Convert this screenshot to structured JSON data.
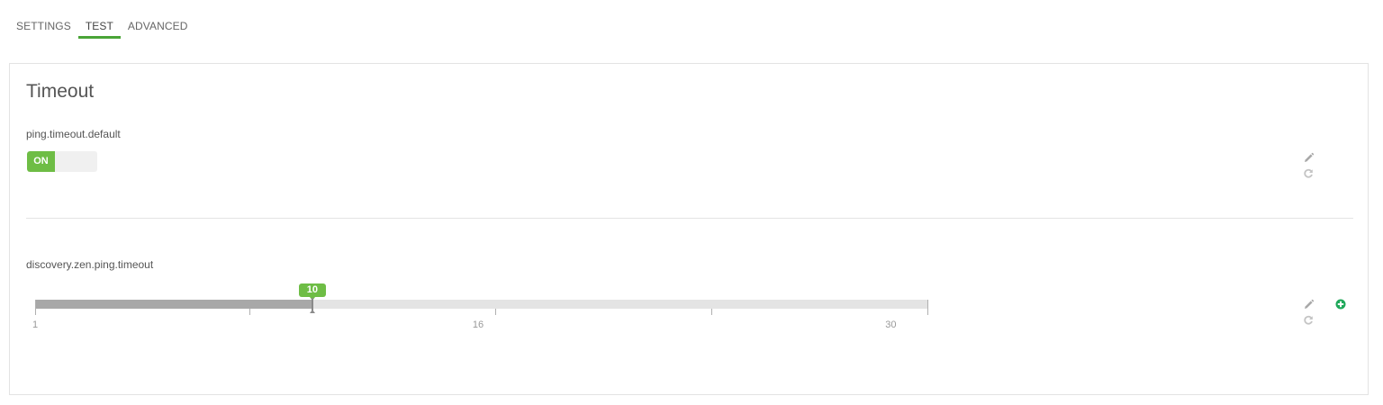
{
  "tabs": [
    {
      "label": "SETTINGS",
      "active": false
    },
    {
      "label": "TEST",
      "active": true
    },
    {
      "label": "ADVANCED",
      "active": false
    }
  ],
  "colors": {
    "accent": "#4aa437",
    "toggle_on": "#6ebd45",
    "add_button": "#1fa85a",
    "slider_fill": "#a8a8a8",
    "slider_track": "#e4e4e4"
  },
  "panel": {
    "title": "Timeout",
    "settings": [
      {
        "label": "ping.timeout.default",
        "type": "toggle",
        "toggle_label": "ON",
        "value": true,
        "icons": [
          "pencil-icon",
          "reset-icon"
        ]
      },
      {
        "label": "discovery.zen.ping.timeout",
        "type": "slider",
        "min": 1,
        "max": 30,
        "value": 10,
        "value_label": "10",
        "tick_labels": [
          "1",
          "16",
          "30"
        ],
        "icons": [
          "pencil-icon",
          "reset-icon",
          "add-icon"
        ]
      }
    ]
  }
}
